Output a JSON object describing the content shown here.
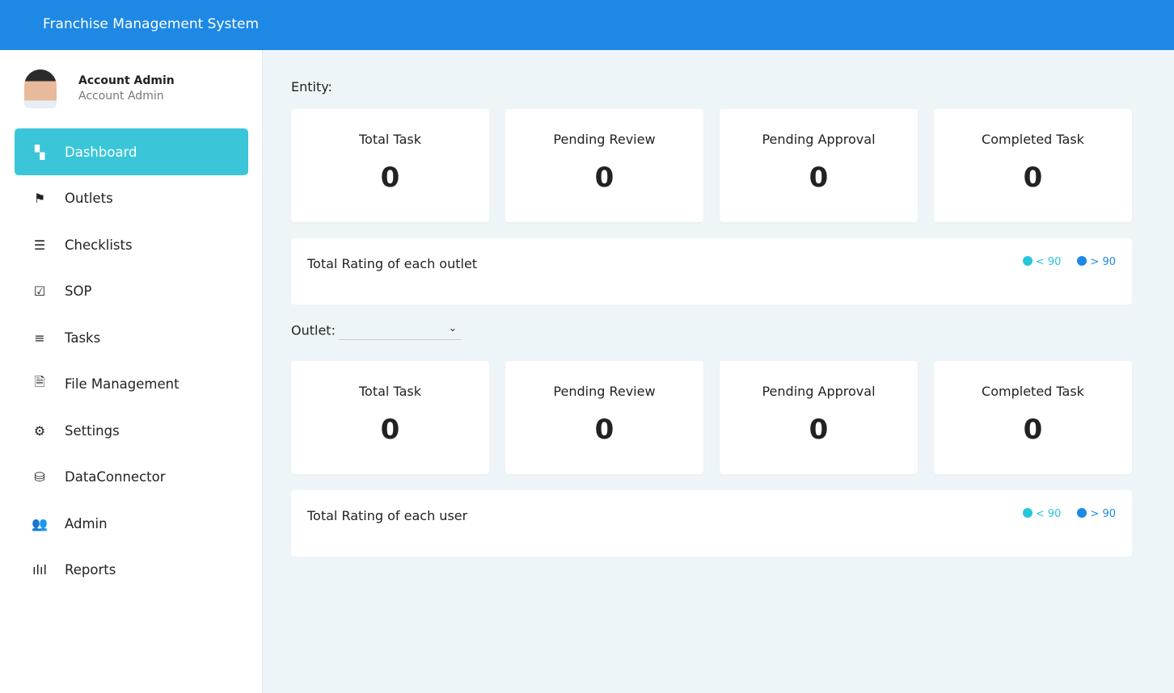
{
  "header": {
    "title": "Franchise Management System"
  },
  "profile": {
    "name": "Account Admin",
    "role": "Account Admin"
  },
  "nav": [
    {
      "label": "Dashboard",
      "icon": "▚"
    },
    {
      "label": "Outlets",
      "icon": "⚑"
    },
    {
      "label": "Checklists",
      "icon": "☰"
    },
    {
      "label": "SOP",
      "icon": "☑"
    },
    {
      "label": "Tasks",
      "icon": "≡"
    },
    {
      "label": "File Management",
      "icon": "🗎"
    },
    {
      "label": "Settings",
      "icon": "⚙"
    },
    {
      "label": "DataConnector",
      "icon": "⛁"
    },
    {
      "label": "Admin",
      "icon": "👥"
    },
    {
      "label": "Reports",
      "icon": "ılıl"
    }
  ],
  "entity": {
    "label": "Entity:",
    "cards": [
      {
        "title": "Total Task",
        "value": "0"
      },
      {
        "title": "Pending Review",
        "value": "0"
      },
      {
        "title": "Pending Approval",
        "value": "0"
      },
      {
        "title": "Completed Task",
        "value": "0"
      }
    ],
    "panel_title": "Total Rating of each outlet"
  },
  "outlet": {
    "label": "Outlet:",
    "selected": "",
    "cards": [
      {
        "title": "Total Task",
        "value": "0"
      },
      {
        "title": "Pending Review",
        "value": "0"
      },
      {
        "title": "Pending Approval",
        "value": "0"
      },
      {
        "title": "Completed Task",
        "value": "0"
      }
    ],
    "panel_title": "Total Rating of each user"
  },
  "legend": [
    {
      "label": "< 90",
      "color": "#26c6da"
    },
    {
      "label": "> 90",
      "color": "#1e88e5"
    }
  ]
}
